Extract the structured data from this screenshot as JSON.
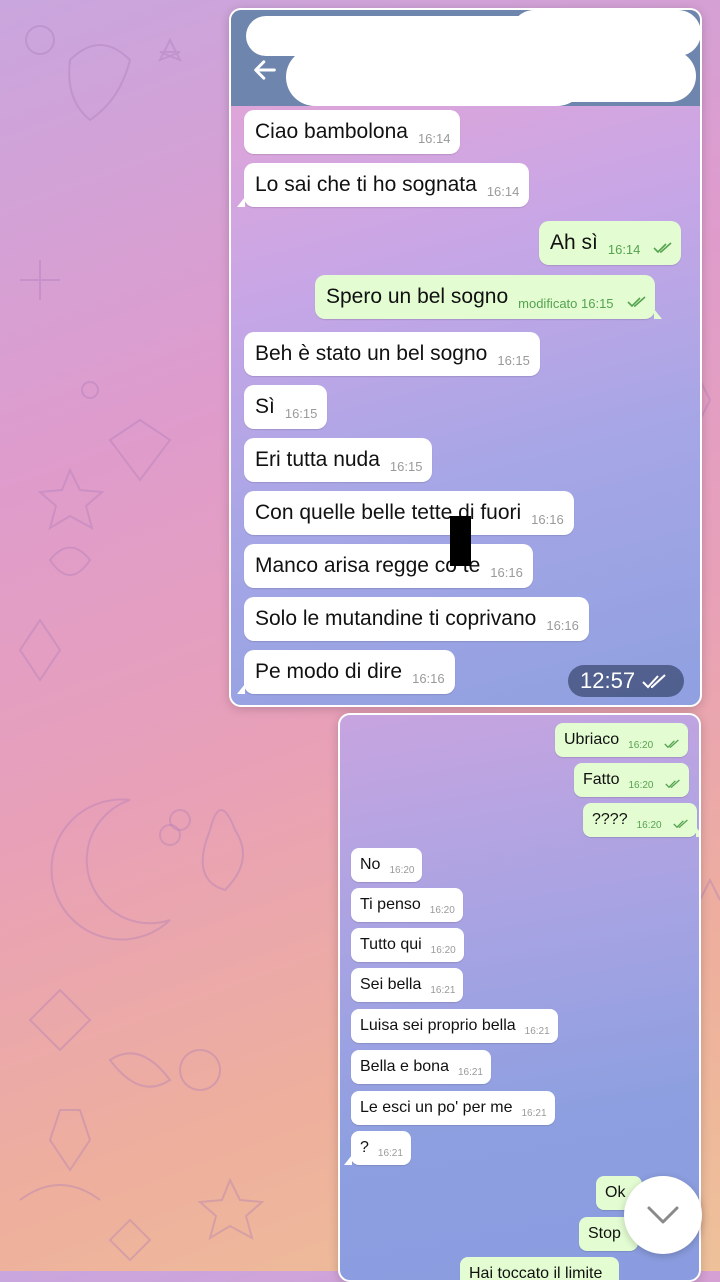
{
  "chat1": {
    "messages": [
      {
        "text": "Ciao bambolona",
        "time": "16:14",
        "dir": "in"
      },
      {
        "text": "Lo sai che ti ho sognata",
        "time": "16:14",
        "dir": "in"
      },
      {
        "text": "Ah sì",
        "time": "16:14",
        "dir": "out",
        "status": "read"
      },
      {
        "text": "Spero un bel sogno",
        "time": "modificato 16:15",
        "dir": "out",
        "status": "read"
      },
      {
        "text": "Beh è stato un bel sogno",
        "time": "16:15",
        "dir": "in"
      },
      {
        "text": "Sì",
        "time": "16:15",
        "dir": "in"
      },
      {
        "text": "Eri tutta nuda",
        "time": "16:15",
        "dir": "in"
      },
      {
        "text": "Con quelle belle tette di fuori",
        "time": "16:16",
        "dir": "in"
      },
      {
        "text": "Manco arisa regge co te",
        "time": "16:16",
        "dir": "in"
      },
      {
        "text": "Solo le mutandine ti coprivano",
        "time": "16:16",
        "dir": "in"
      },
      {
        "text": "Pe modo di dire",
        "time": "16:16",
        "dir": "in"
      }
    ],
    "overlay_time": "12:57"
  },
  "chat2": {
    "messages": [
      {
        "text": "Ubriaco",
        "time": "16:20",
        "dir": "out",
        "status": "read"
      },
      {
        "text": "Fatto",
        "time": "16:20",
        "dir": "out",
        "status": "read"
      },
      {
        "text": "????",
        "time": "16:20",
        "dir": "out",
        "status": "read"
      },
      {
        "text": "No",
        "time": "16:20",
        "dir": "in"
      },
      {
        "text": "Ti penso",
        "time": "16:20",
        "dir": "in"
      },
      {
        "text": "Tutto qui",
        "time": "16:20",
        "dir": "in"
      },
      {
        "text": "Sei bella",
        "time": "16:21",
        "dir": "in"
      },
      {
        "text": "Luisa sei proprio bella",
        "time": "16:21",
        "dir": "in"
      },
      {
        "text": "Bella e bona",
        "time": "16:21",
        "dir": "in"
      },
      {
        "text": "Le esci un po' per me",
        "time": "16:21",
        "dir": "in"
      },
      {
        "text": "?",
        "time": "16:21",
        "dir": "in"
      },
      {
        "text": "Ok",
        "time": "",
        "dir": "out"
      },
      {
        "text": "Stop",
        "time": "",
        "dir": "out"
      },
      {
        "text": "Hai toccato il limite",
        "time": "",
        "dir": "out"
      }
    ]
  },
  "icons": {
    "back": "arrow-left-icon",
    "read_status": "double-check-icon",
    "scroll_down": "chevron-down-icon"
  },
  "colors": {
    "incoming_bubble": "#ffffff",
    "outgoing_bubble": "#e3fcd2",
    "timestamp_outgoing": "#55a34f",
    "header_bar": "#6e86ad"
  }
}
